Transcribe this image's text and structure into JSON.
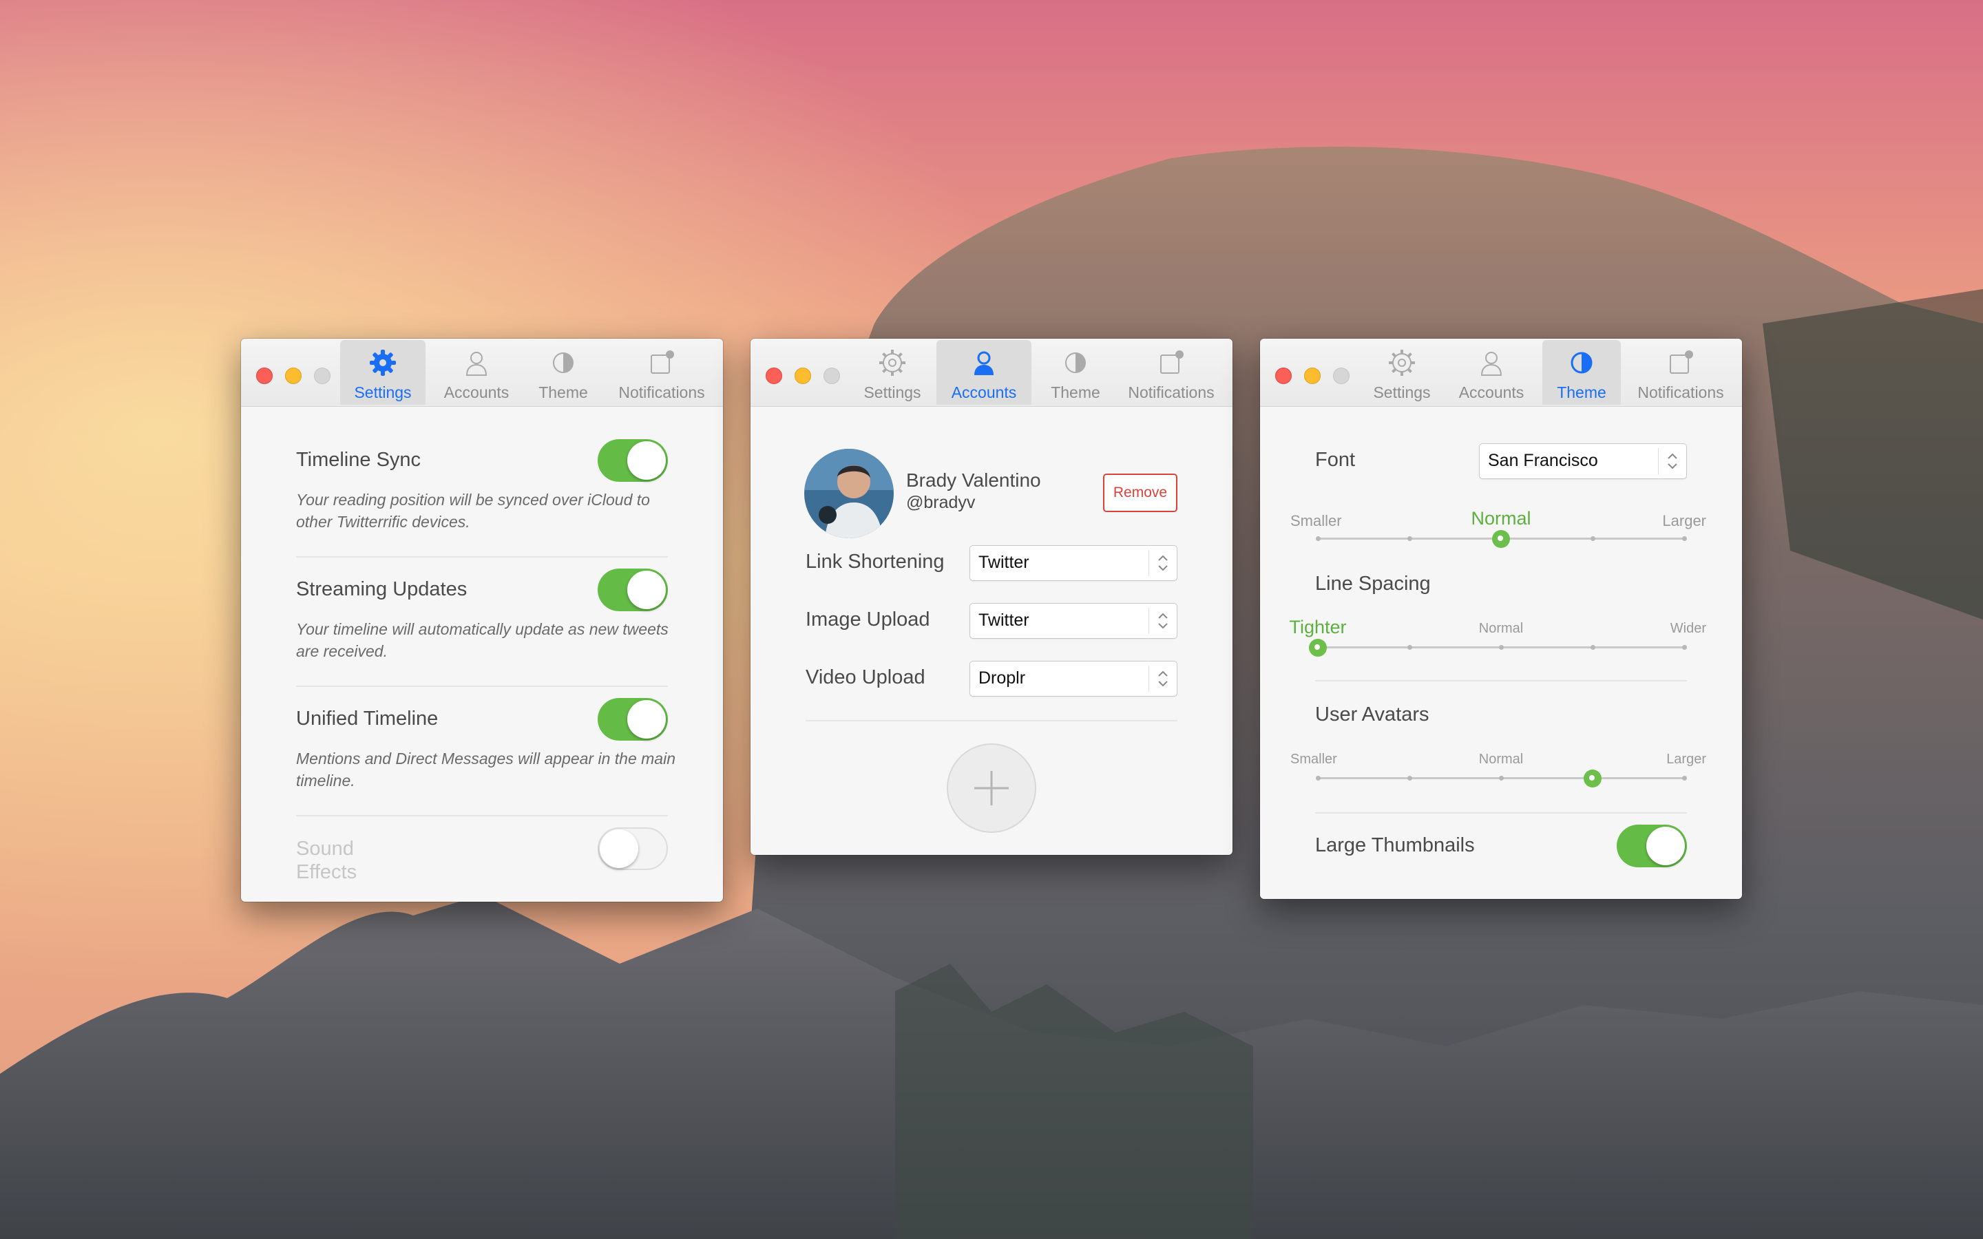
{
  "settings_window": {
    "tabs": [
      {
        "label": "Settings",
        "icon": "gear-icon",
        "active": true
      },
      {
        "label": "Accounts",
        "icon": "person-icon",
        "active": false
      },
      {
        "label": "Theme",
        "icon": "half-circle-icon",
        "active": false
      },
      {
        "label": "Notifications",
        "icon": "notification-icon",
        "active": false
      }
    ],
    "rows": [
      {
        "label": "Timeline Sync",
        "toggle_on": true,
        "description": "Your reading position will be synced over iCloud to other Twitterrific devices."
      },
      {
        "label": "Streaming Updates",
        "toggle_on": true,
        "description": "Your timeline will automatically update as new tweets are received."
      },
      {
        "label": "Unified Timeline",
        "toggle_on": true,
        "description": "Mentions and Direct Messages will appear in the main timeline."
      },
      {
        "label": "Sound Effects",
        "toggle_on": false,
        "enabled": false
      }
    ]
  },
  "accounts_window": {
    "tabs": [
      {
        "label": "Settings",
        "icon": "gear-icon",
        "active": false
      },
      {
        "label": "Accounts",
        "icon": "person-icon",
        "active": true
      },
      {
        "label": "Theme",
        "icon": "half-circle-icon",
        "active": false
      },
      {
        "label": "Notifications",
        "icon": "notification-icon",
        "active": false
      }
    ],
    "account": {
      "name": "Brady Valentino",
      "handle": "@bradyv",
      "remove_label": "Remove"
    },
    "fields": [
      {
        "label": "Link Shortening",
        "value": "Twitter"
      },
      {
        "label": "Image Upload",
        "value": "Twitter"
      },
      {
        "label": "Video Upload",
        "value": "Droplr"
      }
    ]
  },
  "theme_window": {
    "tabs": [
      {
        "label": "Settings",
        "icon": "gear-icon",
        "active": false
      },
      {
        "label": "Accounts",
        "icon": "person-icon",
        "active": false
      },
      {
        "label": "Theme",
        "icon": "half-circle-icon",
        "active": true
      },
      {
        "label": "Notifications",
        "icon": "notification-icon",
        "active": false
      }
    ],
    "font": {
      "label": "Font",
      "value": "San Francisco"
    },
    "font_size": {
      "left": "Smaller",
      "middle": "Normal",
      "right": "Larger",
      "steps": 5,
      "selected_index": 2
    },
    "line_spacing": {
      "label": "Line Spacing",
      "left": "Tighter",
      "middle": "Normal",
      "right": "Wider",
      "steps": 5,
      "selected_index": 0
    },
    "user_avatars": {
      "label": "User Avatars",
      "left": "Smaller",
      "middle": "Normal",
      "right": "Larger",
      "steps": 5,
      "selected_index": 3
    },
    "large_thumbnails": {
      "label": "Large Thumbnails",
      "toggle_on": true
    }
  },
  "colors": {
    "accent": "#1a6ef5",
    "toggle_on": "#64bc47",
    "remove": "#d9433a",
    "slider_selected": "#5cb03f"
  }
}
